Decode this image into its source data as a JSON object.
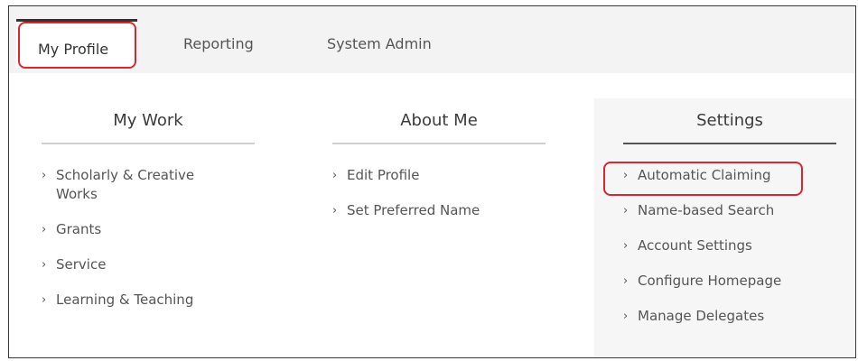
{
  "tabs": {
    "my_profile": "My Profile",
    "reporting": "Reporting",
    "system_admin": "System Admin"
  },
  "columns": {
    "my_work": {
      "header": "My Work",
      "items": [
        "Scholarly & Creative Works",
        "Grants",
        "Service",
        "Learning & Teaching"
      ]
    },
    "about_me": {
      "header": "About Me",
      "items": [
        "Edit Profile",
        "Set Preferred Name"
      ]
    },
    "settings": {
      "header": "Settings",
      "items": [
        "Automatic Claiming",
        "Name-based Search",
        "Account Settings",
        "Configure Homepage",
        "Manage Delegates"
      ]
    }
  },
  "icons": {
    "item_chevron": "chevron-right-icon",
    "chevron_glyph": "›"
  },
  "colors": {
    "highlight": "#d9262f",
    "topbar": "#f3f3f3",
    "settings_panel": "#f6f6f6",
    "text": "#555555"
  }
}
